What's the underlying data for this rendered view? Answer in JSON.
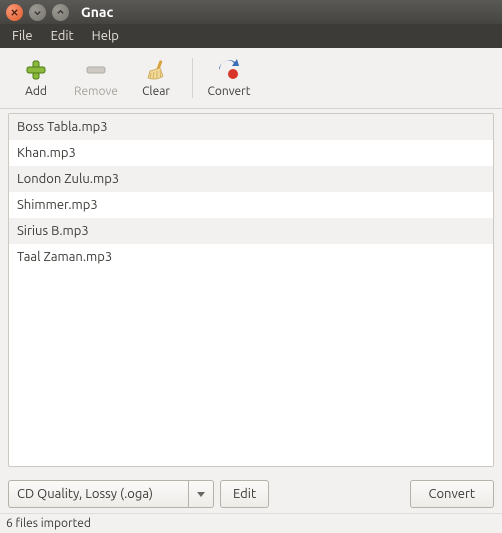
{
  "window": {
    "title": "Gnac"
  },
  "menus": {
    "file": "File",
    "edit": "Edit",
    "help": "Help"
  },
  "toolbar": {
    "add": "Add",
    "remove": "Remove",
    "clear": "Clear",
    "convert": "Convert"
  },
  "files": [
    "Boss Tabla.mp3",
    "Khan.mp3",
    "London Zulu.mp3",
    "Shimmer.mp3",
    "Sirius B.mp3",
    "Taal Zaman.mp3"
  ],
  "profile": {
    "selected": "CD Quality, Lossy (.oga)",
    "edit_label": "Edit"
  },
  "bottom": {
    "convert_label": "Convert"
  },
  "status": "6 files imported"
}
